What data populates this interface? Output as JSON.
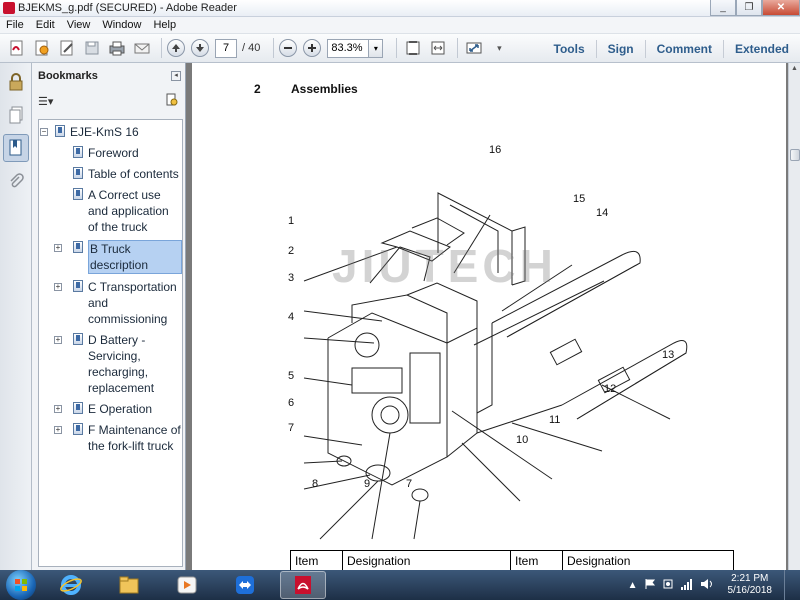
{
  "window": {
    "title": "BJEKMS_g.pdf (SECURED) - Adobe Reader",
    "minimize": "_",
    "restore": "❐",
    "close": "✕"
  },
  "menu": [
    "File",
    "Edit",
    "View",
    "Window",
    "Help"
  ],
  "toolbar": {
    "page_current": "7",
    "page_total": "/ 40",
    "zoom": "83.3%",
    "zoom_dropdown": "▾",
    "right_tabs": [
      "Tools",
      "Sign",
      "Comment",
      "Extended"
    ]
  },
  "bookmarks": {
    "title": "Bookmarks",
    "options_icon": "☰▾",
    "items": [
      {
        "label": "EJE-KmS 16",
        "expander": "−"
      },
      {
        "label": "Foreword"
      },
      {
        "label": "Table of contents"
      },
      {
        "label": "A Correct use and application of the truck"
      },
      {
        "label": "B Truck description",
        "expander": "+",
        "selected": true
      },
      {
        "label": "C Transportation and commissioning",
        "expander": "+"
      },
      {
        "label": "D Battery - Servicing, recharging, replacement",
        "expander": "+"
      },
      {
        "label": "E Operation",
        "expander": "+"
      },
      {
        "label": "F Maintenance of the fork-lift truck",
        "expander": "+"
      }
    ]
  },
  "document": {
    "section_number": "2",
    "section_title": "Assemblies",
    "watermark": "JIUTECH",
    "callouts": [
      "1",
      "2",
      "3",
      "4",
      "5",
      "6",
      "7",
      "8",
      "9",
      "7",
      "10",
      "11",
      "12",
      "13",
      "14",
      "15",
      "16"
    ],
    "table_headers": [
      "Item",
      "Designation",
      "Item",
      "Designation"
    ]
  },
  "taskbar": {
    "start_icon": "start-orb-icon",
    "clock_time": "2:21 PM",
    "clock_date": "5/16/2018"
  }
}
